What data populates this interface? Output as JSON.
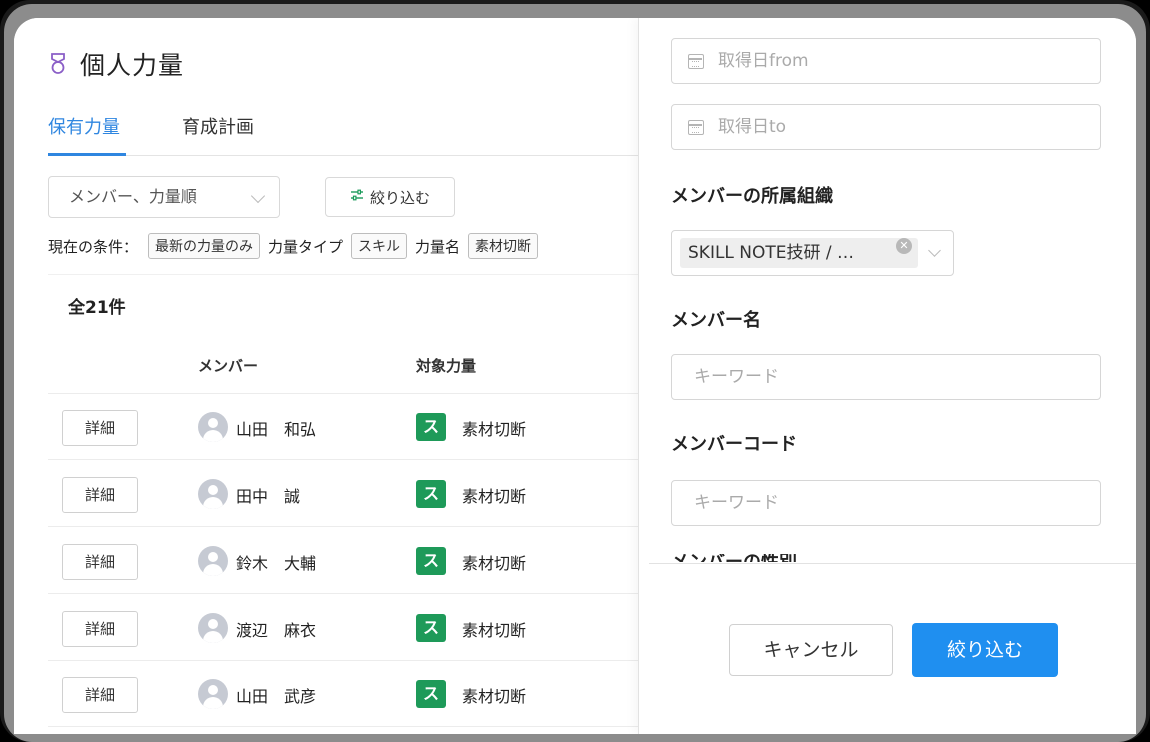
{
  "page": {
    "title": "個人力量"
  },
  "tabs": [
    {
      "label": "保有力量",
      "active": true
    },
    {
      "label": "育成計画",
      "active": false
    }
  ],
  "toolbar": {
    "sort_value": "メンバー、力量順",
    "filter_button_label": "絞り込む"
  },
  "conditions": {
    "prefix": "現在の条件：",
    "latest_tag": "最新の力量のみ",
    "type_label": "力量タイプ",
    "type_tag": "スキル",
    "name_label": "力量名",
    "name_tag": "素材切断"
  },
  "list": {
    "total": "全21件",
    "columns": {
      "member": "メンバー",
      "target": "対象力量"
    },
    "detail_label": "詳細",
    "rows": [
      {
        "name": "山田　和弘",
        "badge": "ス",
        "skill": "素材切断"
      },
      {
        "name": "田中　誠",
        "badge": "ス",
        "skill": "素材切断"
      },
      {
        "name": "鈴木　大輔",
        "badge": "ス",
        "skill": "素材切断"
      },
      {
        "name": "渡辺　麻衣",
        "badge": "ス",
        "skill": "素材切断"
      },
      {
        "name": "山田　武彦",
        "badge": "ス",
        "skill": "素材切断"
      }
    ]
  },
  "drawer": {
    "date_from_placeholder": "取得日from",
    "date_to_placeholder": "取得日to",
    "org_label": "メンバーの所属組織",
    "org_chip": "SKILL NOTE技研 / …",
    "member_name_label": "メンバー名",
    "member_name_placeholder": "キーワード",
    "member_code_label": "メンバーコード",
    "member_code_placeholder": "キーワード",
    "next_section_label": "メンバーの性別",
    "cancel_label": "キャンセル",
    "apply_label": "絞り込む"
  },
  "colors": {
    "accent": "#2f86e0",
    "primary_button": "#1f8ff0",
    "skill_badge": "#1e9a59",
    "medal_icon": "#8b5fc7"
  }
}
